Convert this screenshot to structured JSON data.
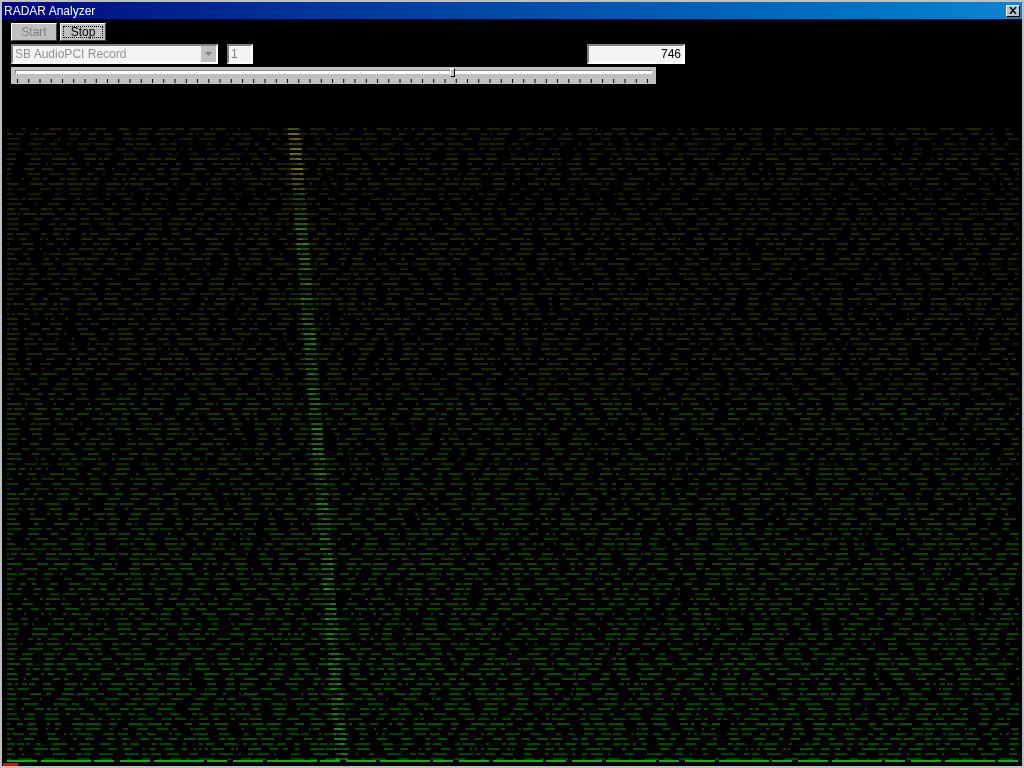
{
  "window": {
    "title": "RADAR Analyzer"
  },
  "buttons": [
    {
      "label": "Start",
      "disabled": true,
      "focused": false
    },
    {
      "label": "Stop",
      "disabled": false,
      "focused": true
    }
  ],
  "device_dropdown": {
    "value": "SB AudioPCI Record",
    "disabled": true
  },
  "channel_field": {
    "value": "1"
  },
  "readout_field": {
    "value": "746"
  },
  "slider": {
    "level": 0.69
  }
}
